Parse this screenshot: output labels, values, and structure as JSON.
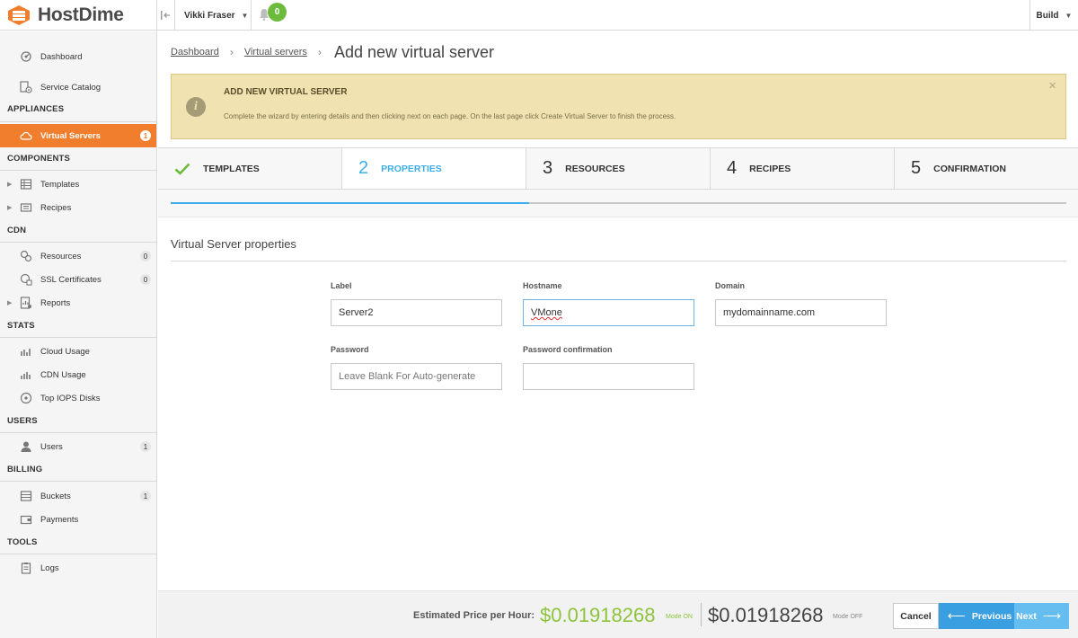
{
  "brand": {
    "name": "HostDime",
    "accent": "#f07e2c"
  },
  "topbar": {
    "collapse_icon": "collapse-sidebar-icon",
    "user_name": "Vikki Fraser",
    "notifications_count": "0",
    "build_label": "Build"
  },
  "sidebar": {
    "dashboard": "Dashboard",
    "service_catalog": "Service Catalog",
    "appliances_head": "APPLIANCES",
    "virtual_servers": "Virtual Servers",
    "virtual_servers_count": "1",
    "components_head": "COMPONENTS",
    "templates": "Templates",
    "recipes": "Recipes",
    "cdn_head": "CDN",
    "resources": "Resources",
    "resources_count": "0",
    "ssl_certificates": "SSL Certificates",
    "ssl_count": "0",
    "reports": "Reports",
    "stats_head": "STATS",
    "cloud_usage": "Cloud Usage",
    "cdn_usage": "CDN Usage",
    "top_iops": "Top IOPS Disks",
    "users_head": "USERS",
    "users": "Users",
    "users_count": "1",
    "billing_head": "BILLING",
    "buckets": "Buckets",
    "buckets_count": "1",
    "payments": "Payments",
    "tools_head": "TOOLS",
    "logs": "Logs"
  },
  "breadcrumb": {
    "items": [
      "Dashboard",
      "Virtual servers"
    ],
    "current": "Add new virtual server"
  },
  "alert": {
    "title": "ADD NEW VIRTUAL SERVER",
    "text": "Complete the wizard by entering details and then clicking next on each page. On the last page click Create Virtual Server to finish the process.",
    "close": "×"
  },
  "wizard": {
    "steps": [
      {
        "num": "",
        "label": "TEMPLATES",
        "state": "done"
      },
      {
        "num": "2",
        "label": "PROPERTIES",
        "state": "active"
      },
      {
        "num": "3",
        "label": "RESOURCES",
        "state": "pending"
      },
      {
        "num": "4",
        "label": "RECIPES",
        "state": "pending"
      },
      {
        "num": "5",
        "label": "CONFIRMATION",
        "state": "pending"
      }
    ],
    "progress": 0.4
  },
  "form": {
    "section_title": "Virtual Server properties",
    "label_label": "Label",
    "label_value": "Server2",
    "hostname_label": "Hostname",
    "hostname_value": "VMone",
    "domain_label": "Domain",
    "domain_value": "mydomainname.com",
    "password_label": "Password",
    "password_placeholder": "Leave Blank For Auto-generate",
    "password_confirm_label": "Password confirmation",
    "password_confirm_value": ""
  },
  "footer": {
    "price_label": "Estimated Price per Hour:",
    "price_on": "$0.01918268",
    "mode_on": "Mode ON",
    "price_off": "$0.01918268",
    "mode_off": "Mode OFF",
    "cancel": "Cancel",
    "previous": "Previous",
    "next": "Next"
  },
  "colors": {
    "active_step": "#3daee9",
    "price_on": "#8dc43c",
    "alert_bg": "#f0e3b1"
  }
}
